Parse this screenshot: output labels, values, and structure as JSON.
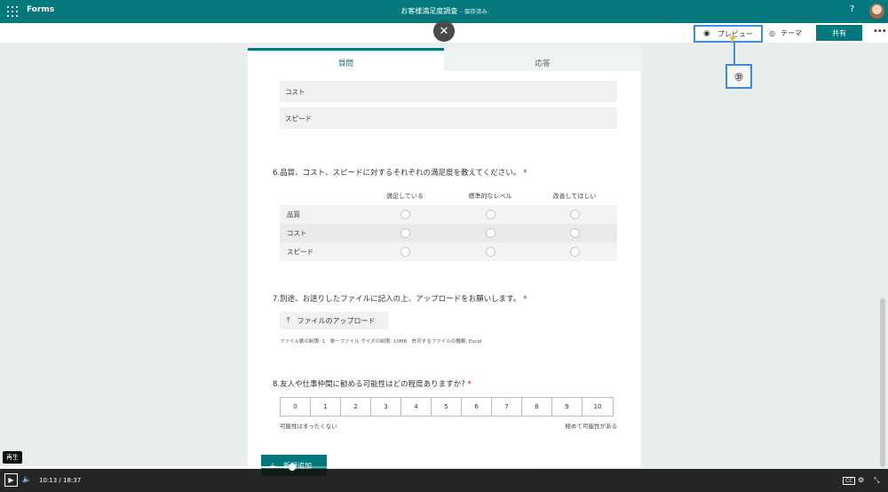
{
  "app": {
    "name": "Forms",
    "doc_title": "お客様満足度調査",
    "save_status": "- 保存済み",
    "help": "?"
  },
  "toolbar": {
    "preview_label": "プレビュー",
    "theme_label": "テーマ",
    "share_label": "共有",
    "more": "•••",
    "close": "✕"
  },
  "callout": {
    "text": "㉛"
  },
  "tabs": {
    "questions": "質問",
    "responses": "応答"
  },
  "q5": {
    "options": [
      "コスト",
      "スピード"
    ]
  },
  "q6": {
    "title": "6.品質、コスト、スピードに対するそれぞれの満足度を教えてください。",
    "required": "*",
    "columns": [
      "満足している",
      "標準的なレベル",
      "改善してほしい"
    ],
    "rows": [
      "品質",
      "コスト",
      "スピード"
    ]
  },
  "q7": {
    "title": "7.別途、お送りしたファイルに記入の上、アップロードをお願いします。",
    "required": "*",
    "upload_label": "ファイルのアップロード",
    "upload_meta": "ファイル数の制限: 1　単一ファイル サイズの制限: 10MB　許可するファイルの種類: Excel"
  },
  "q8": {
    "title": "8.友人や仕事仲間に勧める可能性はどの程度ありますか?",
    "required": "*",
    "scale": [
      "0",
      "1",
      "2",
      "3",
      "4",
      "5",
      "6",
      "7",
      "8",
      "9",
      "10"
    ],
    "low_label": "可能性はまったくない",
    "high_label": "極めて可能性がある"
  },
  "add_new": {
    "label": "新規追加"
  },
  "player": {
    "tooltip": "再生",
    "current_time": "10:13",
    "separator": "/",
    "total_time": "18:37",
    "progress": 0.549
  }
}
